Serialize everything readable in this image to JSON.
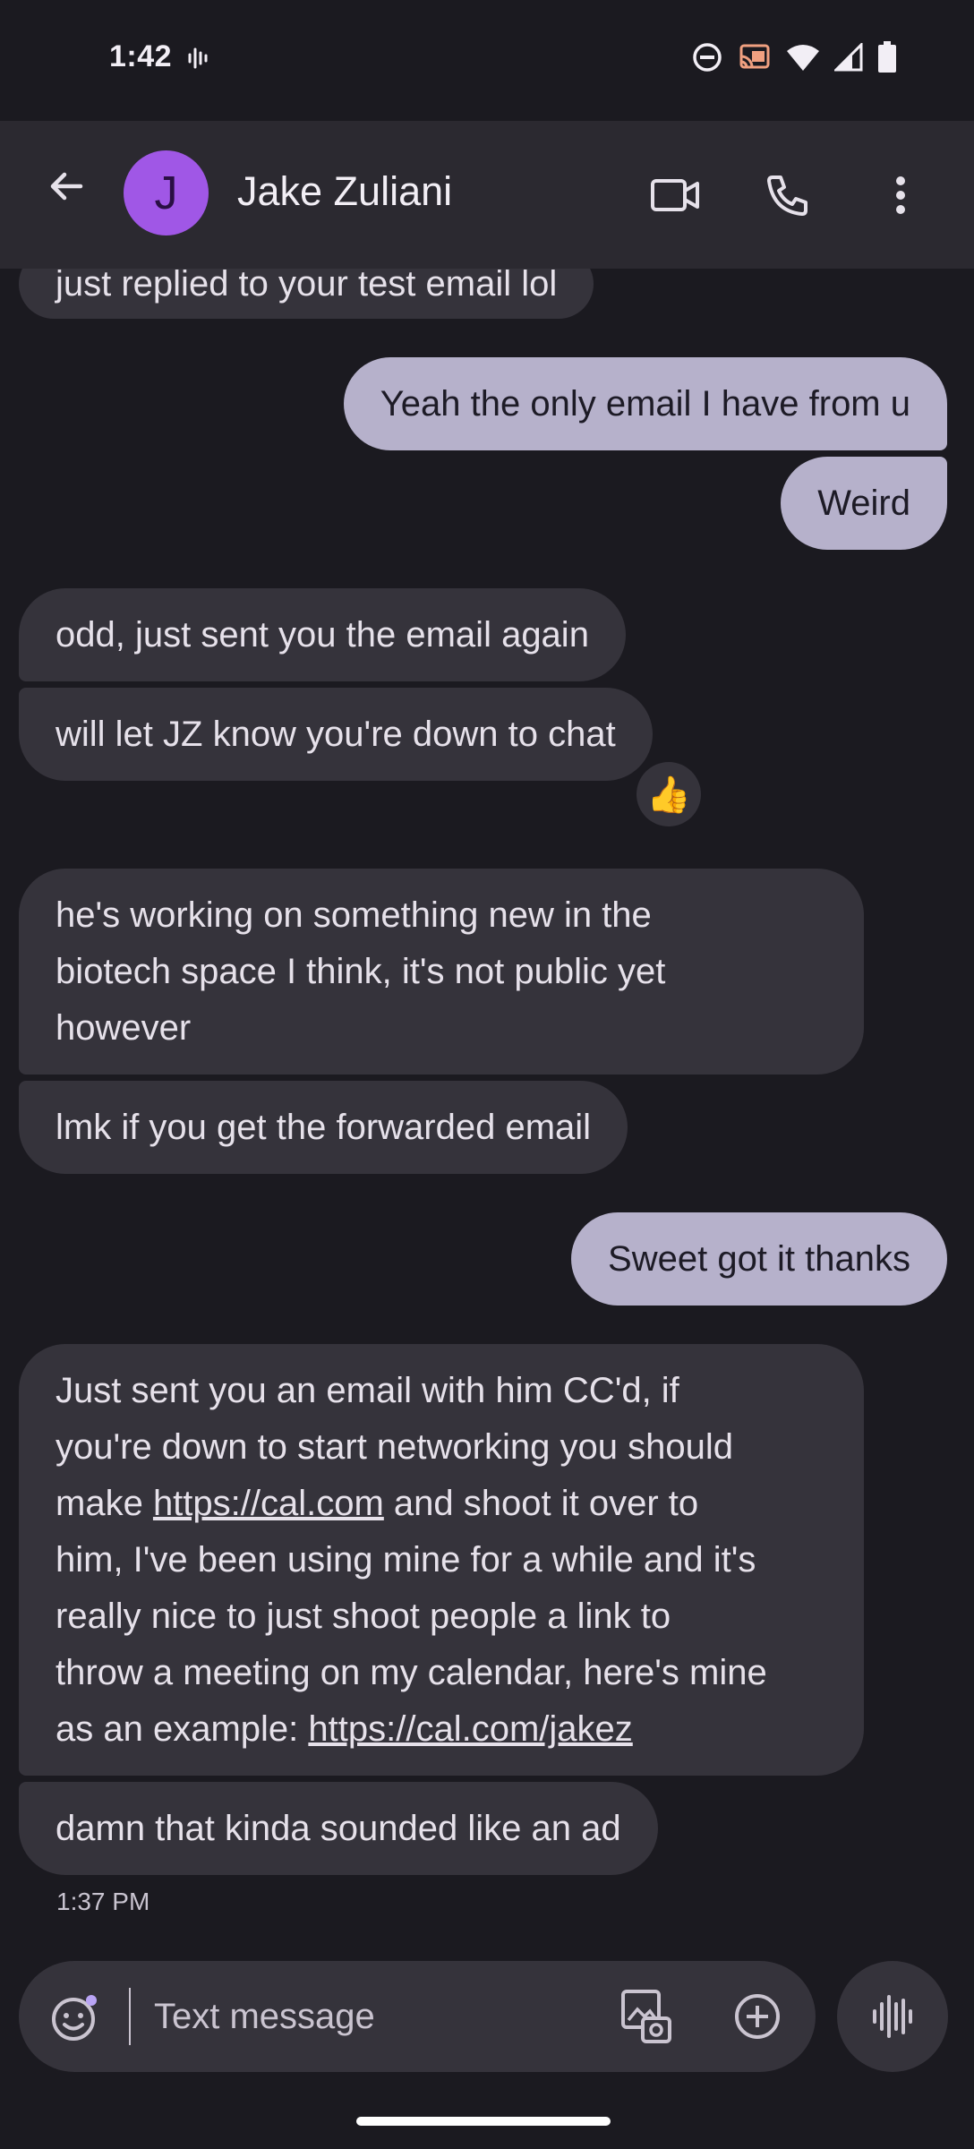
{
  "status_bar": {
    "time": "1:42",
    "icons": [
      "voice-wave-icon",
      "do-not-disturb-icon",
      "cast-icon",
      "wifi-icon",
      "signal-icon",
      "battery-icon"
    ]
  },
  "header": {
    "avatar_initial": "J",
    "avatar_color": "#a057e6",
    "contact_name": "Jake Zuliani",
    "icons": [
      "back-arrow-icon",
      "video-call-icon",
      "phone-icon",
      "more-vert-icon"
    ]
  },
  "messages": [
    {
      "dir": "in",
      "text": "just replied to your test email lol"
    },
    {
      "dir": "out",
      "text": "Yeah the only email I have from u"
    },
    {
      "dir": "out",
      "text": "Weird"
    },
    {
      "dir": "in",
      "text": "odd, just sent you the email again"
    },
    {
      "dir": "in",
      "text": "will let JZ know you're down to chat",
      "reaction": "👍"
    },
    {
      "dir": "in",
      "lines": [
        "he's working on something new in the",
        "biotech space I think, it's not public yet",
        "however"
      ]
    },
    {
      "dir": "in",
      "text": "lmk if you get the forwarded email"
    },
    {
      "dir": "out",
      "text": "Sweet got it thanks"
    },
    {
      "dir": "in",
      "line1": "Just sent you an email with him CC'd, if",
      "line2": "you're down to start networking you should",
      "line3_pre": "make ",
      "line3_link": "https://cal.com",
      "line3_post": " and shoot it over to",
      "line4": "him, I've been using mine for a while and it's",
      "line5": "really nice to just shoot people a link to",
      "line6": "throw a meeting on my calendar, here's mine",
      "line7_pre": "as an example: ",
      "line7_link": "https://cal.com/jakez"
    },
    {
      "dir": "in",
      "text": "damn that kinda sounded like an ad"
    }
  ],
  "last_timestamp": "1:37 PM",
  "composer": {
    "placeholder": "Text message",
    "icons": [
      "emoji-icon",
      "gallery-icon",
      "add-icon",
      "voice-message-icon"
    ]
  },
  "colors": {
    "background": "#1b1a20",
    "incoming_bubble": "#35333b",
    "outgoing_bubble": "#b6b1cb",
    "app_bar": "#2b2930"
  }
}
